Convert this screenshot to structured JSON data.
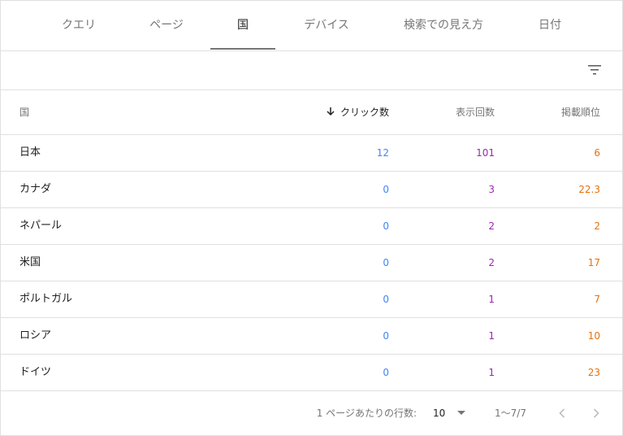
{
  "tabs": [
    {
      "label": "クエリ",
      "active": false
    },
    {
      "label": "ページ",
      "active": false
    },
    {
      "label": "国",
      "active": true
    },
    {
      "label": "デバイス",
      "active": false
    },
    {
      "label": "検索での見え方",
      "active": false
    },
    {
      "label": "日付",
      "active": false
    }
  ],
  "toolbar": {
    "filter_icon": "filter-list-icon"
  },
  "table": {
    "headers": {
      "country": "国",
      "clicks": "クリック数",
      "impressions": "表示回数",
      "position": "掲載順位"
    },
    "sort": {
      "column": "clicks",
      "direction": "descending",
      "icon": "arrow-down-icon"
    },
    "rows": [
      {
        "country": "日本",
        "clicks": "12",
        "impressions": "101",
        "position": "6"
      },
      {
        "country": "カナダ",
        "clicks": "0",
        "impressions": "3",
        "position": "22.3"
      },
      {
        "country": "ネパール",
        "clicks": "0",
        "impressions": "2",
        "position": "2"
      },
      {
        "country": "米国",
        "clicks": "0",
        "impressions": "2",
        "position": "17"
      },
      {
        "country": "ポルトガル",
        "clicks": "0",
        "impressions": "1",
        "position": "7"
      },
      {
        "country": "ロシア",
        "clicks": "0",
        "impressions": "1",
        "position": "10"
      },
      {
        "country": "ドイツ",
        "clicks": "0",
        "impressions": "1",
        "position": "23"
      }
    ]
  },
  "pagination": {
    "rows_per_page_label": "1 ページあたりの行数:",
    "rows_per_page": "10",
    "range": "1〜7/7"
  },
  "colors": {
    "clicks": "#4285f4",
    "impressions": "#9c27b0",
    "position": "#e8710a"
  }
}
